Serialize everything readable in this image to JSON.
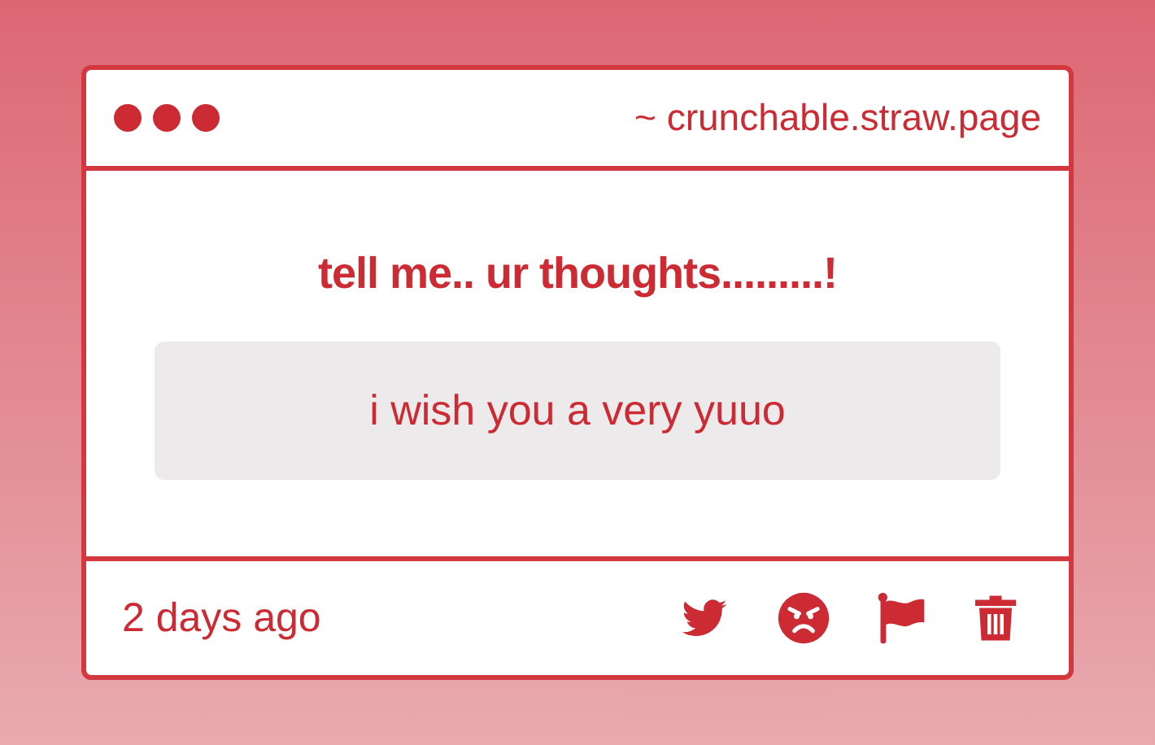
{
  "window": {
    "address": "~ crunchable.straw.page"
  },
  "prompt": "tell me.. ur thoughts.........!",
  "answer": {
    "value": "i wish you a very yuuo"
  },
  "footer": {
    "time": "2 days ago"
  }
}
